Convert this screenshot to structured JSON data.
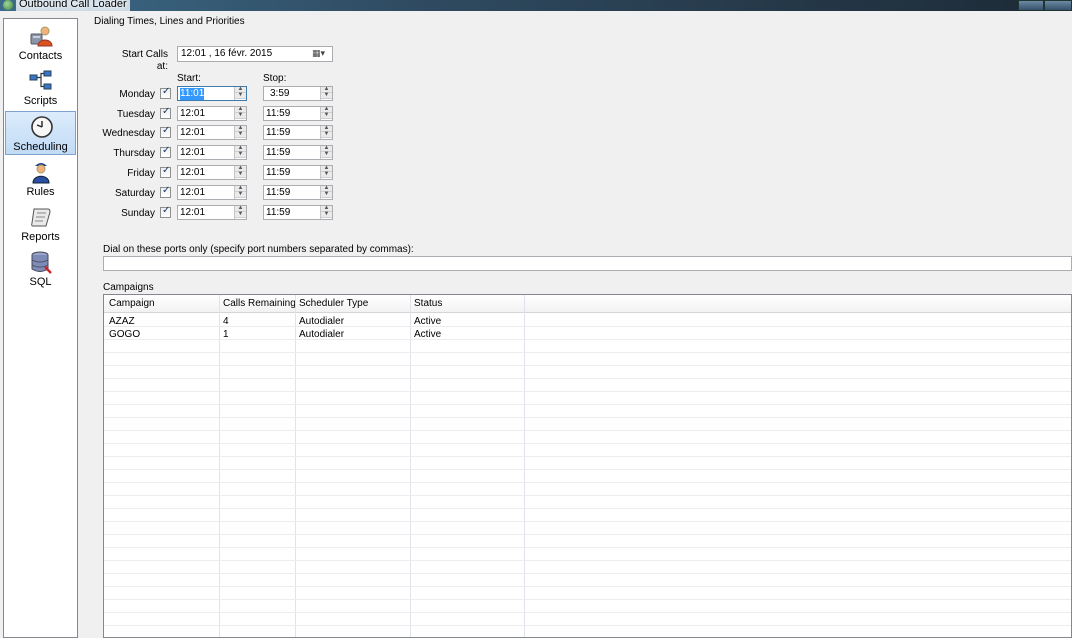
{
  "window": {
    "title": "Outbound Call Loader"
  },
  "sidebar": {
    "items": [
      {
        "label": "Contacts",
        "icon": "contacts-icon"
      },
      {
        "label": "Scripts",
        "icon": "scripts-icon"
      },
      {
        "label": "Scheduling",
        "icon": "clock-icon",
        "active": true
      },
      {
        "label": "Rules",
        "icon": "rules-icon"
      },
      {
        "label": "Reports",
        "icon": "reports-icon"
      },
      {
        "label": "SQL",
        "icon": "database-icon"
      }
    ]
  },
  "scheduling": {
    "section_title": "Dialing Times, Lines and Priorities",
    "start_calls_label": "Start Calls at:",
    "start_calls_value": "12:01 , 16 févr. 2015",
    "start_header": "Start:",
    "stop_header": "Stop:",
    "days": [
      {
        "name": "Monday",
        "checked": true,
        "start": "11:01",
        "stop": "3:59"
      },
      {
        "name": "Tuesday",
        "checked": true,
        "start": "12:01",
        "stop": "11:59"
      },
      {
        "name": "Wednesday",
        "checked": true,
        "start": "12:01",
        "stop": "11:59"
      },
      {
        "name": "Thursday",
        "checked": true,
        "start": "12:01",
        "stop": "11:59"
      },
      {
        "name": "Friday",
        "checked": true,
        "start": "12:01",
        "stop": "11:59"
      },
      {
        "name": "Saturday",
        "checked": true,
        "start": "12:01",
        "stop": "11:59"
      },
      {
        "name": "Sunday",
        "checked": true,
        "start": "12:01",
        "stop": "11:59"
      }
    ],
    "ports_label": "Dial on these ports only (specify port numbers separated by commas):",
    "ports_value": "",
    "campaigns_title": "Campaigns"
  },
  "campaigns": {
    "columns": [
      "Campaign",
      "Calls Remaining",
      "Scheduler Type",
      "Status"
    ],
    "rows": [
      [
        "AZAZ",
        "4",
        "Autodialer",
        "Active"
      ],
      [
        "GOGO",
        "1",
        "Autodialer",
        "Active"
      ]
    ]
  }
}
